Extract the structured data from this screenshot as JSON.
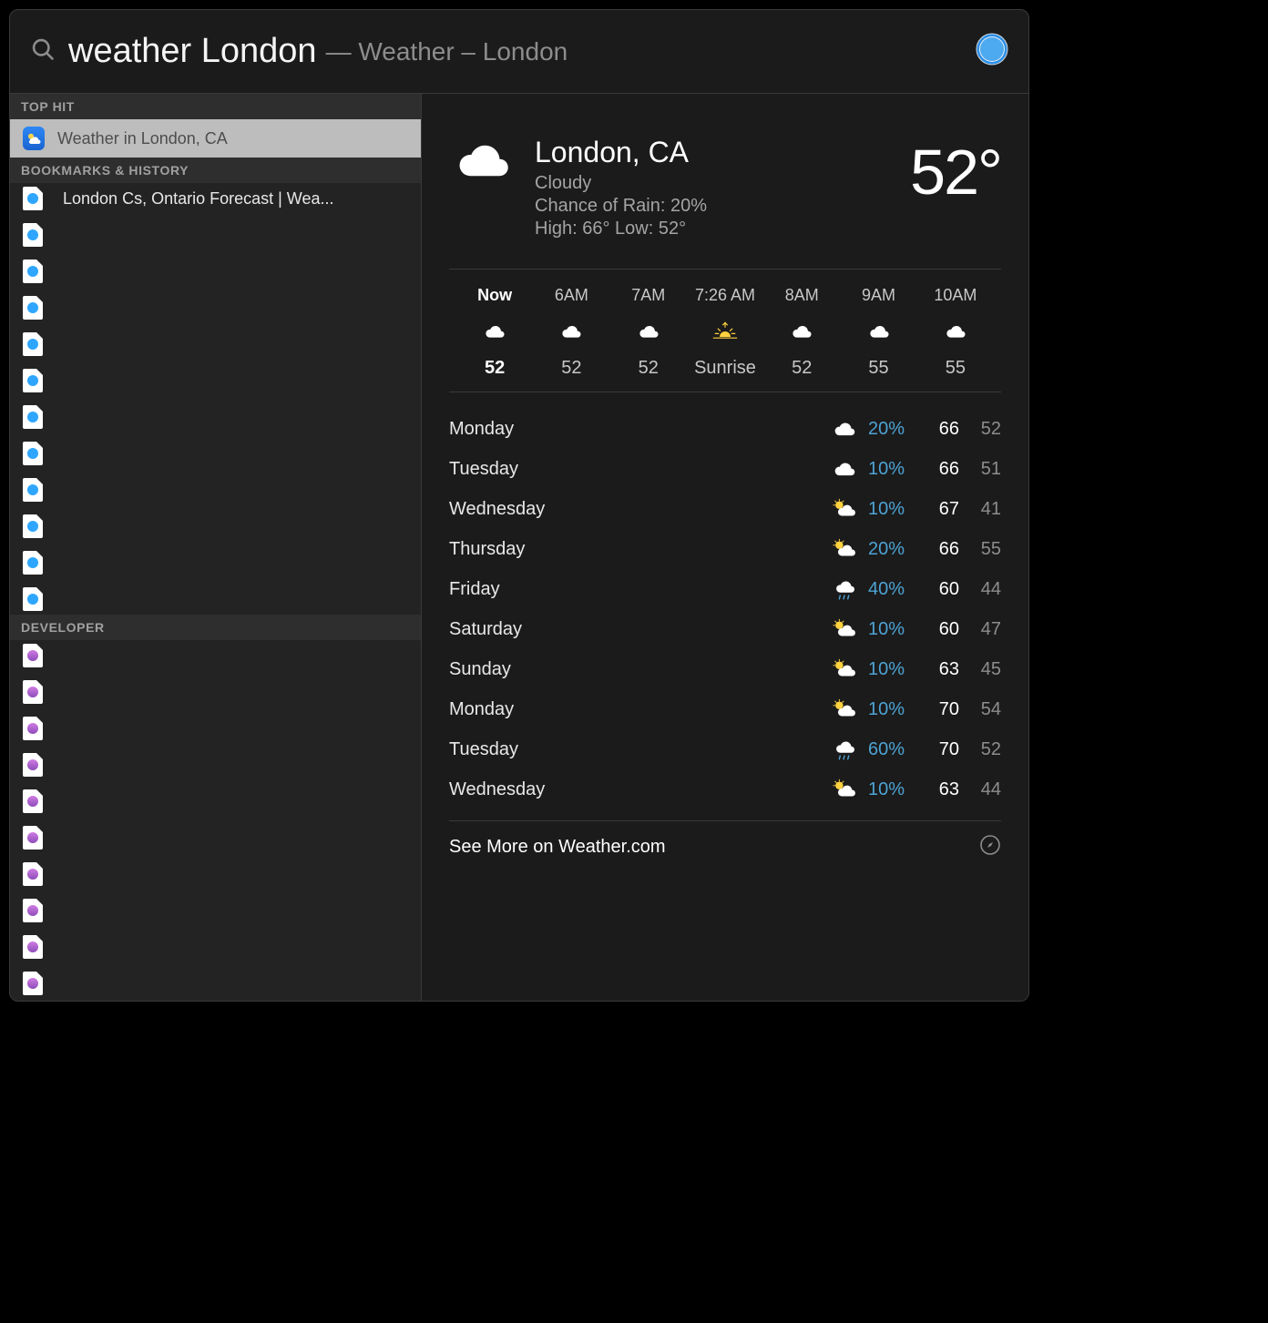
{
  "search": {
    "query": "weather London",
    "suffix": "— Weather – London"
  },
  "sidebar": {
    "sections": {
      "top_hit": {
        "header": "TOP HIT",
        "item": {
          "label": "Weather in London, CA"
        }
      },
      "bookmarks": {
        "header": "BOOKMARKS & HISTORY",
        "first": {
          "label": "London Cs, Ontario Forecast | Wea..."
        }
      },
      "developer": {
        "header": "DEVELOPER"
      }
    }
  },
  "weather": {
    "location": "London, CA",
    "condition": "Cloudy",
    "rain_line": "Chance of Rain: 20%",
    "hilo_line": "High: 66°  Low: 52°",
    "temp": "52°",
    "hourly": [
      {
        "time": "Now",
        "icon": "cloud",
        "temp": "52",
        "now": true
      },
      {
        "time": "6AM",
        "icon": "cloud",
        "temp": "52"
      },
      {
        "time": "7AM",
        "icon": "cloud",
        "temp": "52"
      },
      {
        "time": "7:26 AM",
        "icon": "sunrise",
        "temp": "Sunrise"
      },
      {
        "time": "8AM",
        "icon": "cloud",
        "temp": "52"
      },
      {
        "time": "9AM",
        "icon": "cloud",
        "temp": "55"
      },
      {
        "time": "10AM",
        "icon": "cloud",
        "temp": "55"
      }
    ],
    "daily": [
      {
        "day": "Monday",
        "icon": "cloud",
        "pct": "20%",
        "hi": "66",
        "lo": "52"
      },
      {
        "day": "Tuesday",
        "icon": "cloud",
        "pct": "10%",
        "hi": "66",
        "lo": "51"
      },
      {
        "day": "Wednesday",
        "icon": "partcloud",
        "pct": "10%",
        "hi": "67",
        "lo": "41"
      },
      {
        "day": "Thursday",
        "icon": "partcloud",
        "pct": "20%",
        "hi": "66",
        "lo": "55"
      },
      {
        "day": "Friday",
        "icon": "rain",
        "pct": "40%",
        "hi": "60",
        "lo": "44"
      },
      {
        "day": "Saturday",
        "icon": "partcloud",
        "pct": "10%",
        "hi": "60",
        "lo": "47"
      },
      {
        "day": "Sunday",
        "icon": "partcloud",
        "pct": "10%",
        "hi": "63",
        "lo": "45"
      },
      {
        "day": "Monday",
        "icon": "partcloud",
        "pct": "10%",
        "hi": "70",
        "lo": "54"
      },
      {
        "day": "Tuesday",
        "icon": "rain",
        "pct": "60%",
        "hi": "70",
        "lo": "52"
      },
      {
        "day": "Wednesday",
        "icon": "partcloud",
        "pct": "10%",
        "hi": "63",
        "lo": "44"
      }
    ],
    "see_more": "See More on Weather.com"
  }
}
